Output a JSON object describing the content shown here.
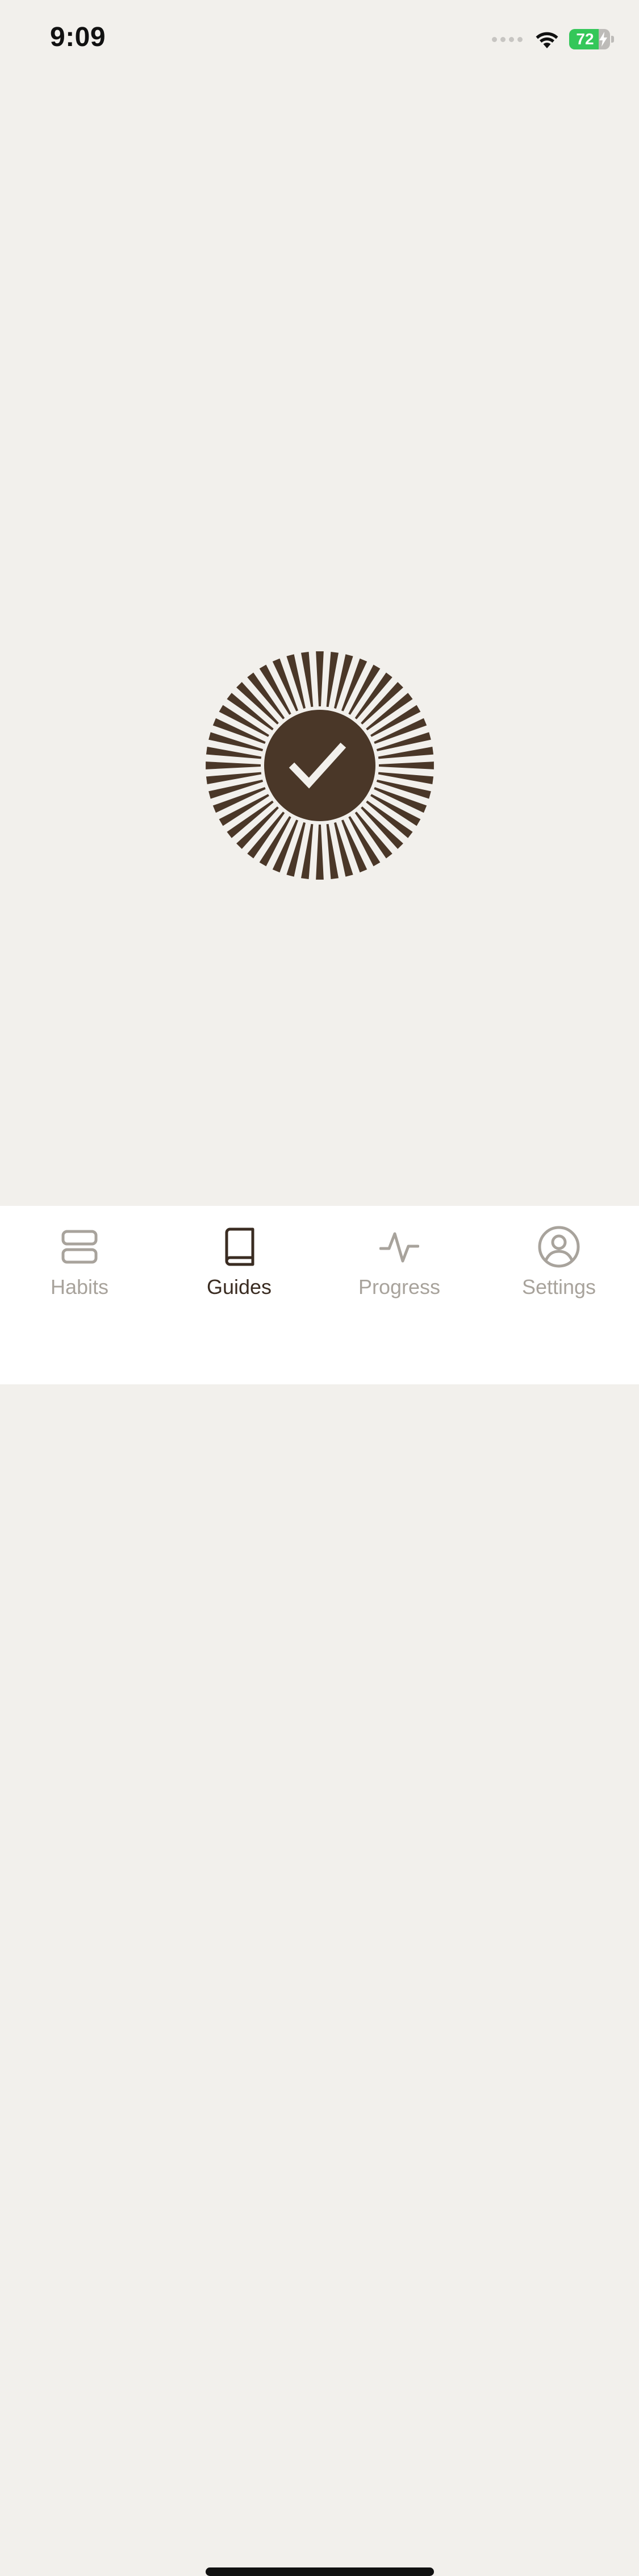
{
  "status_bar": {
    "time": "9:09",
    "battery_level": "72",
    "battery_fraction": 0.72,
    "signal_icon": "cellular-signal-dots",
    "wifi_icon": "wifi-icon",
    "charging_icon": "bolt-icon"
  },
  "main": {
    "completion_icon": "checkmark-sunburst-icon"
  },
  "tab_bar": {
    "tabs": [
      {
        "label": "Habits",
        "icon": "habits-icon",
        "active": false
      },
      {
        "label": "Guides",
        "icon": "book-icon",
        "active": true
      },
      {
        "label": "Progress",
        "icon": "activity-icon",
        "active": false
      },
      {
        "label": "Settings",
        "icon": "person-circle-icon",
        "active": false
      }
    ]
  },
  "colors": {
    "background": "#F2F0EC",
    "accent_dark_brown": "#4A3728",
    "checkmark": "#F2F0EC",
    "tab_inactive": "#A8A39C",
    "tab_active": "#3A2C22",
    "battery_green": "#34C759"
  }
}
